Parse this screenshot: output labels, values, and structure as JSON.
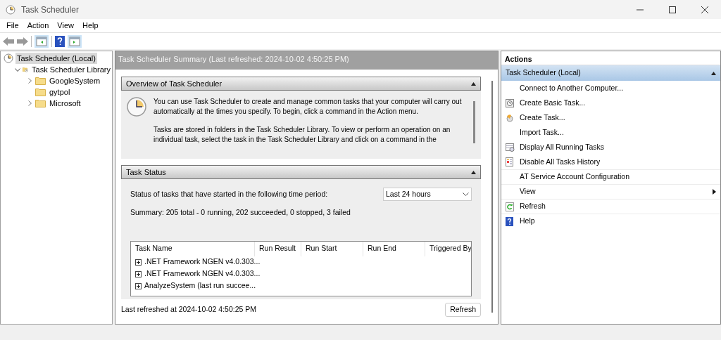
{
  "window": {
    "title": "Task Scheduler"
  },
  "menu": [
    "File",
    "Action",
    "View",
    "Help"
  ],
  "tree": [
    {
      "label": "Task Scheduler (Local)",
      "selected": true,
      "kind": "root",
      "children": [
        {
          "label": "Task Scheduler Library",
          "selected": false,
          "kind": "library",
          "expanded": true,
          "children": [
            {
              "label": "GoogleSystem",
              "selected": false,
              "kind": "folder",
              "expanded": false
            },
            {
              "label": "gytpol",
              "selected": false,
              "kind": "folder"
            },
            {
              "label": "Microsoft",
              "selected": false,
              "kind": "folder",
              "expanded": false
            }
          ]
        }
      ]
    }
  ],
  "summary": {
    "title": "Task Scheduler Summary (Last refreshed: 2024-10-02 4:50:25 PM)",
    "overview": {
      "title": "Overview of Task Scheduler",
      "paragraphs": [
        "You can use Task Scheduler to create and manage common tasks that your computer will carry out automatically at the times you specify. To begin, click a command in the Action menu.",
        "Tasks are stored in folders in the Task Scheduler Library. To view or perform an operation on an individual task, select the task in the Task Scheduler Library and click on a command in the"
      ]
    },
    "task_status": {
      "title": "Task Status",
      "period_label": "Status of tasks that have started in the following time period:",
      "period": "Last 24 hours",
      "summary": "Summary: 205 total - 0 running, 202 succeeded, 0 stopped, 3 failed",
      "columns": [
        "Task Name",
        "Run Result",
        "Run Start",
        "Run End",
        "Triggered By"
      ],
      "rows": [
        ".NET Framework NGEN v4.0.303...",
        ".NET Framework NGEN v4.0.303...",
        "AnalyzeSystem (last run succee..."
      ]
    },
    "footer": "Last refreshed at 2024-10-02 4:50:25 PM",
    "refresh_button": "Refresh"
  },
  "actions": {
    "title": "Actions",
    "group": "Task Scheduler (Local)",
    "items": [
      {
        "label": "Connect to Another Computer...",
        "kind": "plain"
      },
      {
        "label": "Create Basic Task...",
        "kind": "basic_task"
      },
      {
        "label": "Create Task...",
        "kind": "new_task"
      },
      {
        "label": "Import Task...",
        "kind": "plain"
      },
      {
        "label": "Display All Running Tasks",
        "kind": "running"
      },
      {
        "label": "Disable All Tasks History",
        "kind": "history"
      },
      {
        "label": "AT Service Account Configuration",
        "kind": "section"
      },
      {
        "label": "View",
        "kind": "submenu"
      },
      {
        "label": "Refresh",
        "kind": "refresh"
      },
      {
        "label": "Help",
        "kind": "help"
      }
    ]
  }
}
